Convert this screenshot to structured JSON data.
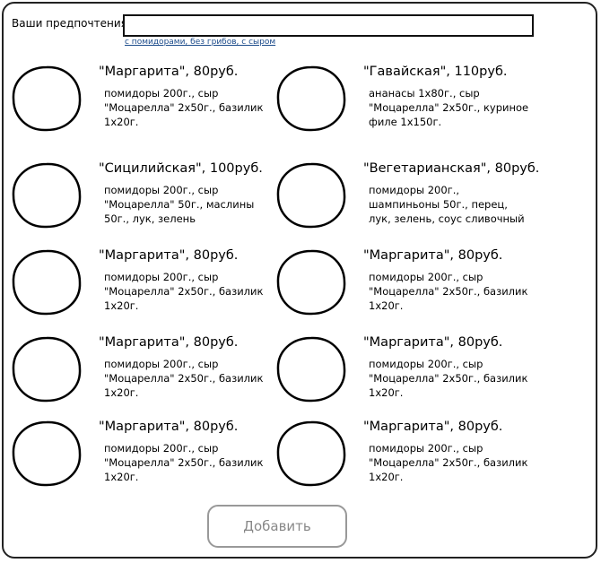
{
  "preferences": {
    "label": "Ваши предпочтения:",
    "value": "",
    "hint": "с помидорами, без грибов, с сыром"
  },
  "pizzas": [
    {
      "title": "\"Маргарита\", 80руб.",
      "desc": "помидоры 200г., сыр \"Моцарелла\" 2x50г., базилик 1x20г."
    },
    {
      "title": "\"Гавайская\", 110руб.",
      "desc": "ананасы 1x80г., сыр \"Моцарелла\" 2x50г., куриное филе 1x150г."
    },
    {
      "title": "\"Сицилийская\", 100руб.",
      "desc": "помидоры 200г., сыр \"Моцарелла\" 50г., маслины 50г., лук, зелень"
    },
    {
      "title": "\"Вегетарианская\", 80руб.",
      "desc": "помидоры 200г., шампиньоны 50г., перец, лук, зелень, соус сливочный"
    },
    {
      "title": "\"Маргарита\", 80руб.",
      "desc": "помидоры 200г., сыр \"Моцарелла\" 2x50г., базилик 1x20г."
    },
    {
      "title": "\"Маргарита\", 80руб.",
      "desc": "помидоры 200г., сыр \"Моцарелла\" 2x50г., базилик 1x20г."
    },
    {
      "title": "\"Маргарита\", 80руб.",
      "desc": "помидоры 200г., сыр \"Моцарелла\" 2x50г., базилик 1x20г."
    },
    {
      "title": "\"Маргарита\", 80руб.",
      "desc": "помидоры 200г., сыр \"Моцарелла\" 2x50г., базилик 1x20г."
    },
    {
      "title": "\"Маргарита\", 80руб.",
      "desc": "помидоры 200г., сыр \"Моцарелла\" 2x50г., базилик 1x20г."
    },
    {
      "title": "\"Маргарита\", 80руб.",
      "desc": "помидоры 200г., сыр \"Моцарелла\" 2x50г., базилик 1x20г."
    }
  ],
  "add_button_label": "Добавить"
}
